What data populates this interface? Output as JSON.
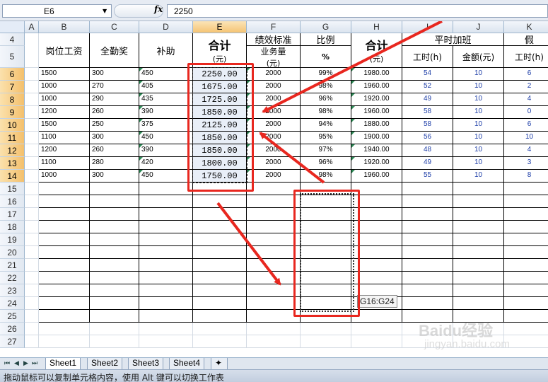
{
  "formula_bar": {
    "name_box": "E6",
    "fx_label": "fx",
    "formula": "2250"
  },
  "columns": [
    "A",
    "B",
    "C",
    "D",
    "E",
    "F",
    "G",
    "H",
    "I",
    "J",
    "K"
  ],
  "rows": [
    "4",
    "5",
    "6",
    "7",
    "8",
    "9",
    "10",
    "11",
    "12",
    "13",
    "14",
    "15",
    "16",
    "17",
    "18",
    "19",
    "20",
    "21",
    "22",
    "23",
    "24",
    "25",
    "26",
    "27"
  ],
  "headers": {
    "b": "岗位工资",
    "c": "全勤奖",
    "d": "补助",
    "e1": "合计",
    "e2": "(元)",
    "f1": "绩效标准",
    "f2": "业务量",
    "f3": "(元)",
    "g1": "比例",
    "g2": "%",
    "h1": "合计",
    "h2": "(元)",
    "ij": "平时加班",
    "i": "工时(h)",
    "j": "金额(元)",
    "k1": "假",
    "k2": "工时(h)"
  },
  "data_rows": [
    {
      "b": "1500",
      "c": "300",
      "d": "450",
      "e": "2250.00",
      "f": "2000",
      "g": "99%",
      "h": "1980.00",
      "i": "54",
      "j": "10",
      "k": "6"
    },
    {
      "b": "1000",
      "c": "270",
      "d": "405",
      "e": "1675.00",
      "f": "2000",
      "g": "98%",
      "h": "1960.00",
      "i": "52",
      "j": "10",
      "k": "2"
    },
    {
      "b": "1000",
      "c": "290",
      "d": "435",
      "e": "1725.00",
      "f": "2000",
      "g": "96%",
      "h": "1920.00",
      "i": "49",
      "j": "10",
      "k": "4"
    },
    {
      "b": "1200",
      "c": "260",
      "d": "390",
      "e": "1850.00",
      "f": "2000",
      "g": "98%",
      "h": "1960.00",
      "i": "58",
      "j": "10",
      "k": "0"
    },
    {
      "b": "1500",
      "c": "250",
      "d": "375",
      "e": "2125.00",
      "f": "2000",
      "g": "94%",
      "h": "1880.00",
      "i": "58",
      "j": "10",
      "k": "6"
    },
    {
      "b": "1100",
      "c": "300",
      "d": "450",
      "e": "1850.00",
      "f": "2000",
      "g": "95%",
      "h": "1900.00",
      "i": "56",
      "j": "10",
      "k": "10"
    },
    {
      "b": "1200",
      "c": "260",
      "d": "390",
      "e": "1850.00",
      "f": "2000",
      "g": "97%",
      "h": "1940.00",
      "i": "48",
      "j": "10",
      "k": "4"
    },
    {
      "b": "1100",
      "c": "280",
      "d": "420",
      "e": "1800.00",
      "f": "2000",
      "g": "96%",
      "h": "1920.00",
      "i": "49",
      "j": "10",
      "k": "3"
    },
    {
      "b": "1000",
      "c": "300",
      "d": "450",
      "e": "1750.00",
      "f": "2000",
      "g": "98%",
      "h": "1960.00",
      "i": "55",
      "j": "10",
      "k": "8"
    }
  ],
  "drag_tooltip": "G16:G24",
  "sheet_tabs": [
    "Sheet1",
    "Sheet2",
    "Sheet3",
    "Sheet4"
  ],
  "status_text": "拖动鼠标可以复制单元格内容，使用 Alt 键可以切换工作表",
  "watermark": {
    "brand": "Baidu经验",
    "url": "jingyan.baidu.com"
  },
  "colors": {
    "annotation": "#e8271f",
    "selected_header": "#f5c474",
    "number_blue": "#1f3fa8"
  }
}
